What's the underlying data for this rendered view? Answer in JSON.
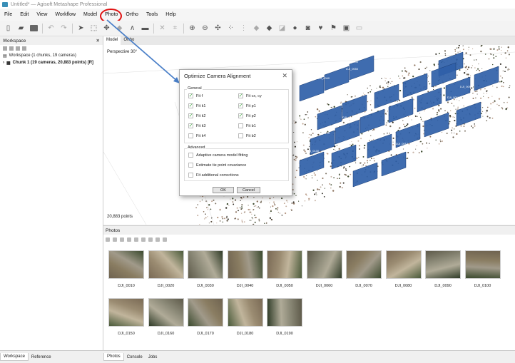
{
  "window": {
    "title": "Untitled* — Agisoft Metashape Professional"
  },
  "menu": [
    {
      "label": "File"
    },
    {
      "label": "Edit"
    },
    {
      "label": "View"
    },
    {
      "label": "Workflow"
    },
    {
      "label": "Model"
    },
    {
      "label": "Photo",
      "highlighted": true
    },
    {
      "label": "Ortho"
    },
    {
      "label": "Tools"
    },
    {
      "label": "Help"
    }
  ],
  "workspace": {
    "title": "Workspace",
    "tree": [
      {
        "label": "Workspace (1 chunks, 19 cameras)"
      },
      {
        "label": "Chunk 1 (19 cameras, 20,883 points) [R]"
      }
    ],
    "tabs": [
      "Workspace",
      "Reference"
    ]
  },
  "viewport": {
    "tabs": [
      "Model",
      "Ortho"
    ],
    "projection": "Perspective 30°",
    "points": "20,883 points",
    "camera_labels": [
      "DJI_0130",
      "DJI_0120",
      "DJI_0110",
      "DJI_0010",
      "DJI_0090",
      "DJI_0080",
      "DJI_0040",
      "DJI_0050",
      "DJI_0060",
      "DJI_0150",
      "DJI_0170"
    ]
  },
  "dialog": {
    "title": "Optimize Camera Alignment",
    "general_label": "General",
    "options_left": [
      {
        "label": "Fit f",
        "checked": true
      },
      {
        "label": "Fit k1",
        "checked": true
      },
      {
        "label": "Fit k2",
        "checked": true
      },
      {
        "label": "Fit k3",
        "checked": true
      },
      {
        "label": "Fit k4",
        "checked": false
      }
    ],
    "options_right": [
      {
        "label": "Fit cx, cy",
        "checked": true
      },
      {
        "label": "Fit p1",
        "checked": true
      },
      {
        "label": "Fit p2",
        "checked": true
      },
      {
        "label": "Fit b1",
        "checked": false
      },
      {
        "label": "Fit b2",
        "checked": false
      }
    ],
    "advanced_label": "Advanced",
    "advanced": [
      {
        "label": "Adaptive camera model fitting",
        "checked": false
      },
      {
        "label": "Estimate tie point covariance",
        "checked": false
      },
      {
        "label": "Fit additional corrections",
        "checked": false
      }
    ],
    "ok": "OK",
    "cancel": "Cancel"
  },
  "photos": {
    "title": "Photos",
    "tabs": [
      "Photos",
      "Console",
      "Jobs"
    ],
    "items": [
      "DJI_0010",
      "DJI_0020",
      "DJI_0030",
      "DJI_0040",
      "DJI_0050",
      "DJI_0060",
      "DJI_0070",
      "DJI_0080",
      "DJI_0090",
      "DJI_0100",
      "DJI_0150",
      "DJI_0160",
      "DJI_0170",
      "DJI_0180",
      "DJI_0190"
    ]
  },
  "colors": {
    "annotation_red": "#e01010",
    "annotation_arrow": "#4a7fc8",
    "camera_blue": "#2f5fa8",
    "check_green": "#3aa33a"
  }
}
